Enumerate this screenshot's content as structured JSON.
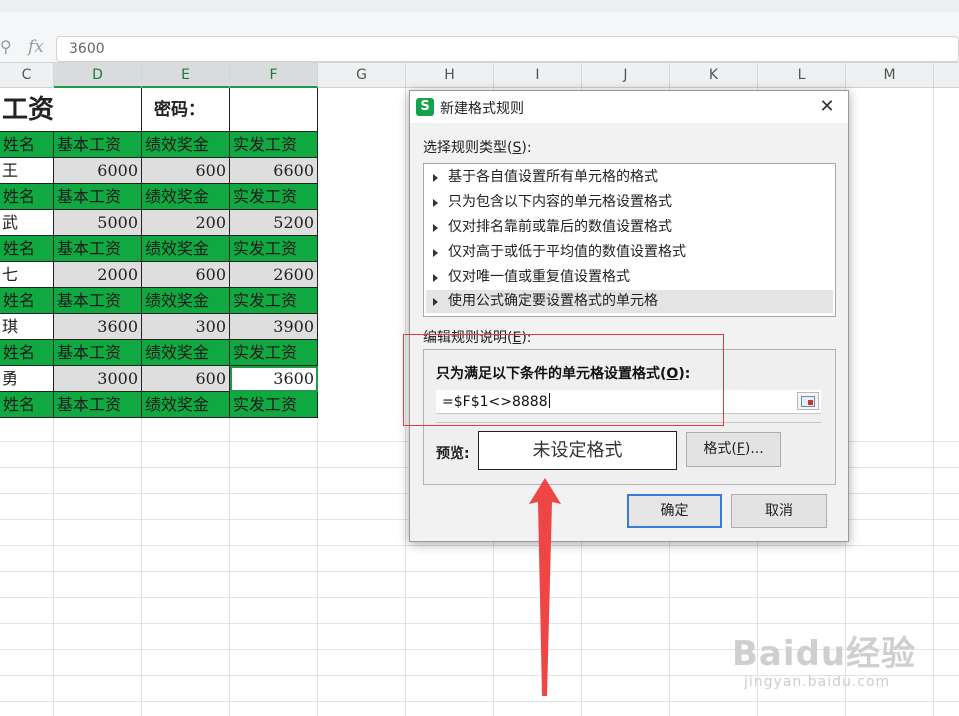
{
  "formula_bar": {
    "value": "3600",
    "fx": "fx"
  },
  "columns": [
    "C",
    "D",
    "E",
    "F",
    "G",
    "H",
    "I",
    "J",
    "K",
    "L",
    "M"
  ],
  "sheet": {
    "title": "工资",
    "password_label": "密码：",
    "header_row": [
      "姓名",
      "基本工资",
      "绩效奖金",
      "实发工资"
    ],
    "rows": [
      {
        "name": "王",
        "base": "6000",
        "bonus": "600",
        "total": "6600"
      },
      {
        "name": "武",
        "base": "5000",
        "bonus": "200",
        "total": "5200"
      },
      {
        "name": "七",
        "base": "2000",
        "bonus": "600",
        "total": "2600"
      },
      {
        "name": "琪",
        "base": "3600",
        "bonus": "300",
        "total": "3900"
      },
      {
        "name": "勇",
        "base": "3000",
        "bonus": "600",
        "total": "3600"
      }
    ]
  },
  "dialog": {
    "title": "新建格式规则",
    "select_type_label": "选择规则类型(",
    "select_type_key": "S",
    "select_type_suffix": "):",
    "rules": [
      "基于各自值设置所有单元格的格式",
      "只为包含以下内容的单元格设置格式",
      "仅对排名靠前或靠后的数值设置格式",
      "仅对高于或低于平均值的数值设置格式",
      "仅对唯一值或重复值设置格式",
      "使用公式确定要设置格式的单元格"
    ],
    "edit_desc_label": "编辑规则说明(",
    "edit_desc_key": "E",
    "edit_desc_suffix": "):",
    "condition_label": "只为满足以下条件的单元格设置格式(",
    "condition_key": "O",
    "condition_suffix": "):",
    "formula": "=$F$1<>8888",
    "preview_label": "预览:",
    "preview_text": "未设定格式",
    "format_button": "格式(",
    "format_key": "F",
    "format_suffix": ")...",
    "ok": "确定",
    "cancel": "取消"
  },
  "watermark": {
    "logo": "Baidu经验",
    "url": "jingyan.baidu.com"
  },
  "colors": {
    "green": "#10a840",
    "accent": "#3a7bd5",
    "annotation": "#e23b3b"
  }
}
